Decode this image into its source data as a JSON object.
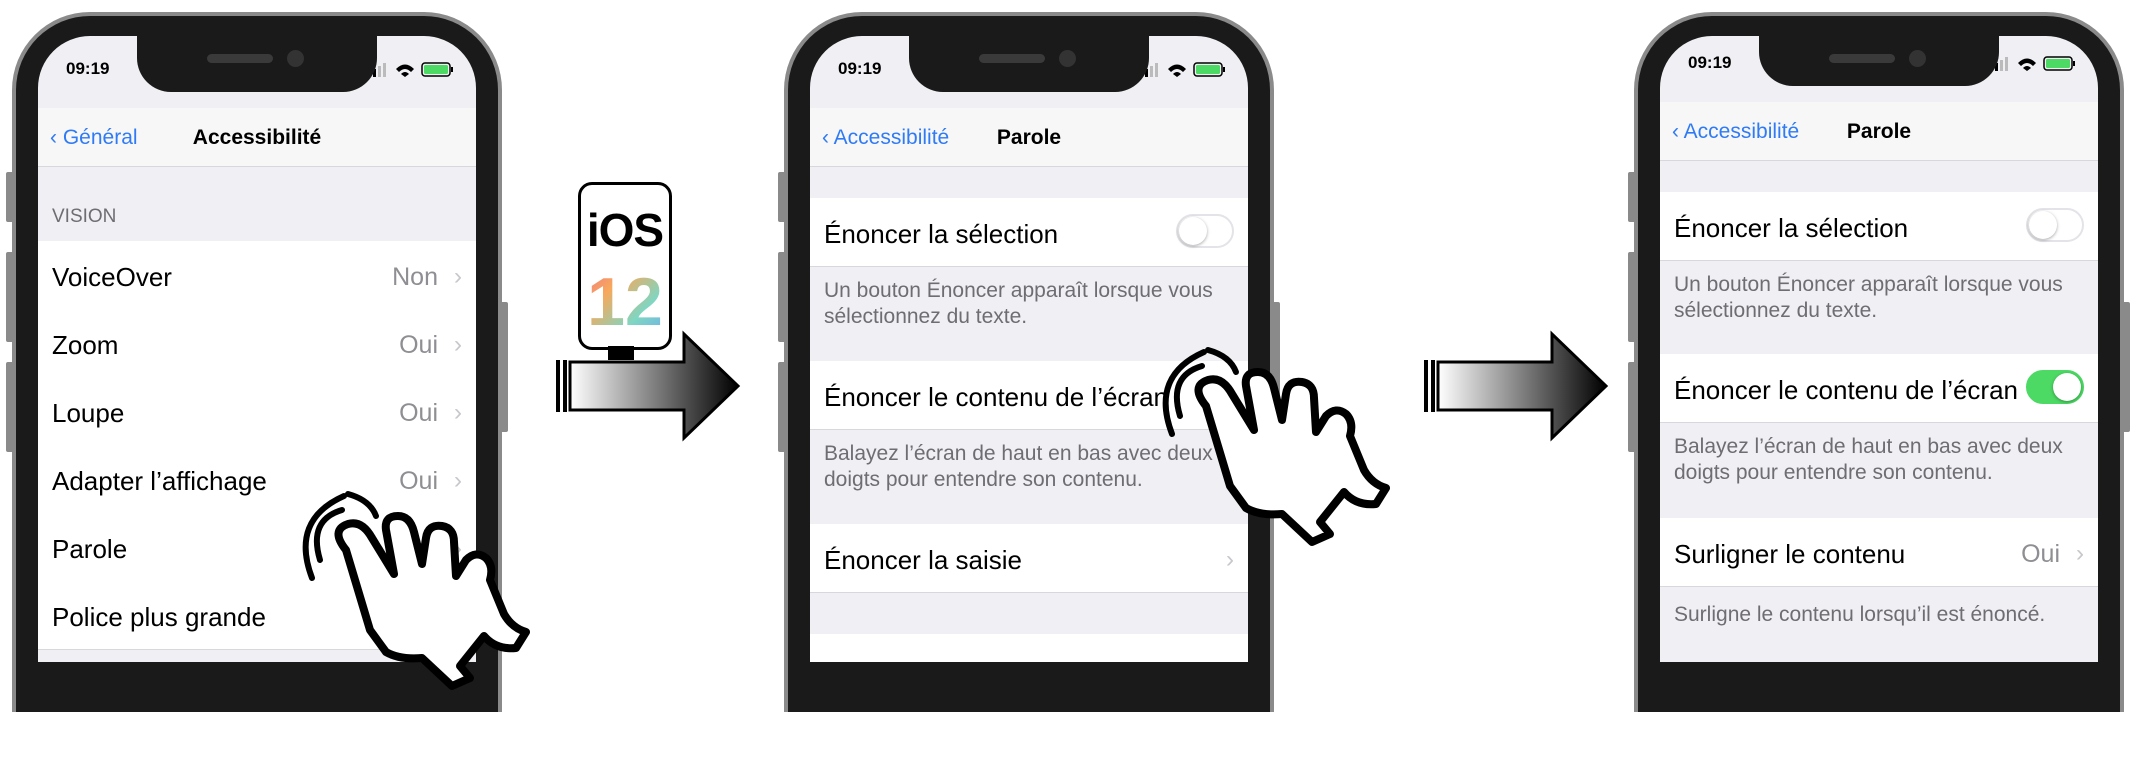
{
  "phones": [
    {
      "status": {
        "time": "09:19"
      },
      "nav": {
        "back": "Général",
        "title": "Accessibilité"
      },
      "section": "VISION",
      "rows": [
        {
          "label": "VoiceOver",
          "value": "Non"
        },
        {
          "label": "Zoom",
          "value": "Oui"
        },
        {
          "label": "Loupe",
          "value": "Oui"
        },
        {
          "label": "Adapter l’affichage",
          "value": "Oui"
        },
        {
          "label": "Parole",
          "value": ""
        },
        {
          "label": "Police plus grande",
          "value": ""
        }
      ]
    },
    {
      "status": {
        "time": "09:19"
      },
      "nav": {
        "back": "Accessibilité",
        "title": "Parole"
      },
      "rows": [
        {
          "label": "Énoncer la sélection",
          "toggle": "off"
        },
        {
          "label": "Énoncer le contenu de l’écran",
          "toggle": "none"
        },
        {
          "label": "Énoncer la saisie",
          "chevron": true
        }
      ],
      "footers": [
        "Un bouton Énoncer apparaît lorsque vous sélectionnez du texte.",
        "Balayez l’écran de haut en bas avec deux doigts pour entendre son contenu."
      ]
    },
    {
      "status": {
        "time": "09:19"
      },
      "nav": {
        "back": "Accessibilité",
        "title": "Parole"
      },
      "rows": [
        {
          "label": "Énoncer la sélection",
          "toggle": "off"
        },
        {
          "label": "Énoncer le contenu de l’écran",
          "toggle": "on"
        },
        {
          "label": "Surligner le contenu",
          "value": "Oui"
        }
      ],
      "footers": [
        "Un bouton Énoncer apparaît lorsque vous sélectionnez du texte.",
        "Balayez l’écran de haut en bas avec deux doigts pour entendre son contenu.",
        "Surligne le contenu lorsqu’il est énoncé."
      ]
    }
  ],
  "badge": {
    "os": "iOS",
    "version": "12"
  },
  "colors": {
    "link": "#2f7bf5",
    "toggle_on": "#4cd964",
    "background": "#efeff4"
  },
  "icons": [
    "back-chevron-icon",
    "location-arrow-icon",
    "signal-icon",
    "wifi-icon",
    "battery-icon",
    "tap-hand-icon",
    "right-arrow-icon",
    "ios-badge-icon"
  ]
}
